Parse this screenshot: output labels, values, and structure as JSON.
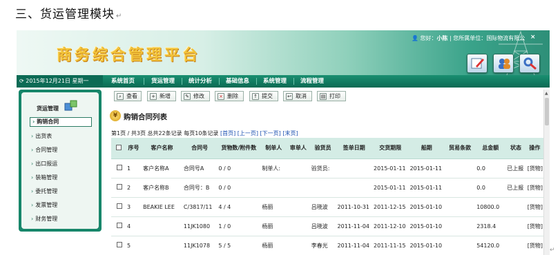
{
  "doc_heading": "三、货运管理模块",
  "banner": {
    "logo": "商务综合管理平台",
    "user_prefix": "您好：",
    "user_name": "小陈",
    "unit_text": "| 您所属单位：",
    "unit_name": "国际物流有限公",
    "close": "×"
  },
  "date_text": "2015年12月21日 星期一",
  "nav": [
    "系统首页",
    "货运管理",
    "统计分析",
    "基础信息",
    "系统管理",
    "流程管理"
  ],
  "sidebar": {
    "title": "货运管理",
    "items": [
      "购销合同",
      "出货表",
      "合同管理",
      "出口报运",
      "装箱管理",
      "委托管理",
      "发票管理",
      "财务管理"
    ]
  },
  "toolbar": {
    "view": "查看",
    "add": "新增",
    "edit": "修改",
    "delete": "删除",
    "submit": "提交",
    "cancel": "取消",
    "print": "打印"
  },
  "list_title": "购销合同列表",
  "pager": {
    "info": "第1页 / 共3页  总共22条记录 每页10条记录",
    "first": "[首页]",
    "prev": "[上一页]",
    "next": "[下一页]",
    "last": "[末页]"
  },
  "columns": [
    "",
    "序号",
    "客户名称",
    "合同号",
    "货物数/附件数",
    "制单人",
    "审单人",
    "验货员",
    "签单日期",
    "交货期限",
    "船期",
    "贸易条款",
    "总金额",
    "状态",
    "操作"
  ],
  "rows": [
    {
      "no": "1",
      "customer": "客户名称A",
      "contract": "合同号A",
      "qty": "0 / 0",
      "maker": "制单人:",
      "checker": "",
      "inspector": "验货员:",
      "sign": "",
      "delivery": "2015-01-11",
      "ship": "2015-01-11",
      "trade": "",
      "amount": "0.0",
      "status": "已上报",
      "op": "[货物]"
    },
    {
      "no": "2",
      "customer": "客户名称B",
      "contract": "合同号：B",
      "qty": "0 / 0",
      "maker": "",
      "checker": "",
      "inspector": "",
      "sign": "",
      "delivery": "2015-01-11",
      "ship": "2015-01-11",
      "trade": "",
      "amount": "0.0",
      "status": "已上报",
      "op": "[货物]"
    },
    {
      "no": "3",
      "customer": "BEAKIE LEE",
      "contract": "C/3817/11",
      "qty": "4 / 4",
      "maker": "杨丽",
      "checker": "",
      "inspector": "吕晓波",
      "sign": "2011-10-31",
      "delivery": "2011-12-15",
      "ship": "2015-01-10",
      "trade": "",
      "amount": "10800.0",
      "status": "",
      "op": "[货物]"
    },
    {
      "no": "4",
      "customer": "",
      "contract": "11JK1080",
      "qty": "1 / 0",
      "maker": "杨丽",
      "checker": "",
      "inspector": "吕晓波",
      "sign": "2011-11-04",
      "delivery": "2011-12-10",
      "ship": "2015-01-10",
      "trade": "",
      "amount": "2318.4",
      "status": "",
      "op": "[货物]"
    },
    {
      "no": "5",
      "customer": "",
      "contract": "11JK1078",
      "qty": "5 / 5",
      "maker": "杨丽",
      "checker": "",
      "inspector": "李春光",
      "sign": "2011-11-04",
      "delivery": "2011-11-15",
      "ship": "2015-01-10",
      "trade": "",
      "amount": "54120.0",
      "status": "",
      "op": "[货物]"
    }
  ]
}
